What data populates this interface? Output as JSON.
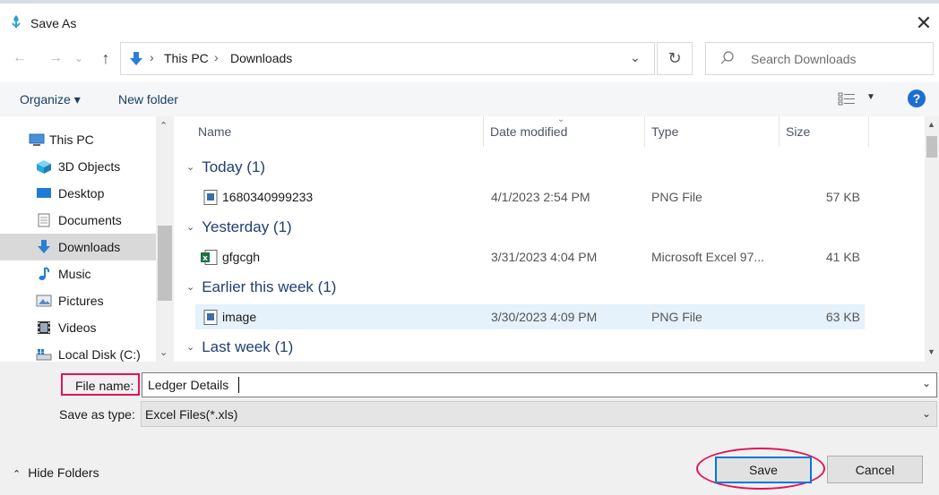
{
  "window": {
    "title": "Save As",
    "close_glyph": "✕"
  },
  "nav": {
    "back_glyph": "←",
    "forward_glyph": "→",
    "recent_glyph": "⌄",
    "up_glyph": "↑",
    "breadcrumb": [
      "This PC",
      "Downloads"
    ],
    "breadcrumb_sep": "›",
    "dropdown_glyph": "⌄",
    "refresh_glyph": "↻",
    "search_placeholder": "Search Downloads"
  },
  "toolbar": {
    "organize": "Organize ▾",
    "new_folder": "New folder",
    "view_caret": "▼",
    "help": "?"
  },
  "sidebar": {
    "items": [
      {
        "label": "This PC",
        "icon": "computer-icon"
      },
      {
        "label": "3D Objects",
        "icon": "cube-icon"
      },
      {
        "label": "Desktop",
        "icon": "desktop-icon"
      },
      {
        "label": "Documents",
        "icon": "document-icon"
      },
      {
        "label": "Downloads",
        "icon": "download-icon",
        "selected": true
      },
      {
        "label": "Music",
        "icon": "music-icon"
      },
      {
        "label": "Pictures",
        "icon": "pictures-icon"
      },
      {
        "label": "Videos",
        "icon": "videos-icon"
      },
      {
        "label": "Local Disk (C:)",
        "icon": "disk-icon"
      }
    ]
  },
  "files": {
    "columns": [
      "Name",
      "Date modified",
      "Type",
      "Size"
    ],
    "groups": [
      {
        "label": "Today (1)",
        "rows": [
          {
            "name": "1680340999233",
            "date": "4/1/2023 2:54 PM",
            "type": "PNG File",
            "size": "57 KB",
            "icon": "image-file-icon"
          }
        ]
      },
      {
        "label": "Yesterday (1)",
        "rows": [
          {
            "name": "gfgcgh",
            "date": "3/31/2023 4:04 PM",
            "type": "Microsoft Excel 97...",
            "size": "41 KB",
            "icon": "excel-file-icon"
          }
        ]
      },
      {
        "label": "Earlier this week (1)",
        "rows": [
          {
            "name": "image",
            "date": "3/30/2023 4:09 PM",
            "type": "PNG File",
            "size": "63 KB",
            "icon": "image-file-icon",
            "selected": true
          }
        ]
      },
      {
        "label": "Last week (1)",
        "rows": []
      }
    ]
  },
  "form": {
    "file_name_label": "File name:",
    "file_name_value": "Ledger Details",
    "save_type_label": "Save as type:",
    "save_type_value": "Excel Files(*.xls)"
  },
  "footer": {
    "hide_folders": "Hide Folders",
    "save": "Save",
    "cancel": "Cancel"
  },
  "colors": {
    "accent": "#0078d7",
    "highlight": "#e3125a",
    "group_text": "#1f3f73"
  }
}
